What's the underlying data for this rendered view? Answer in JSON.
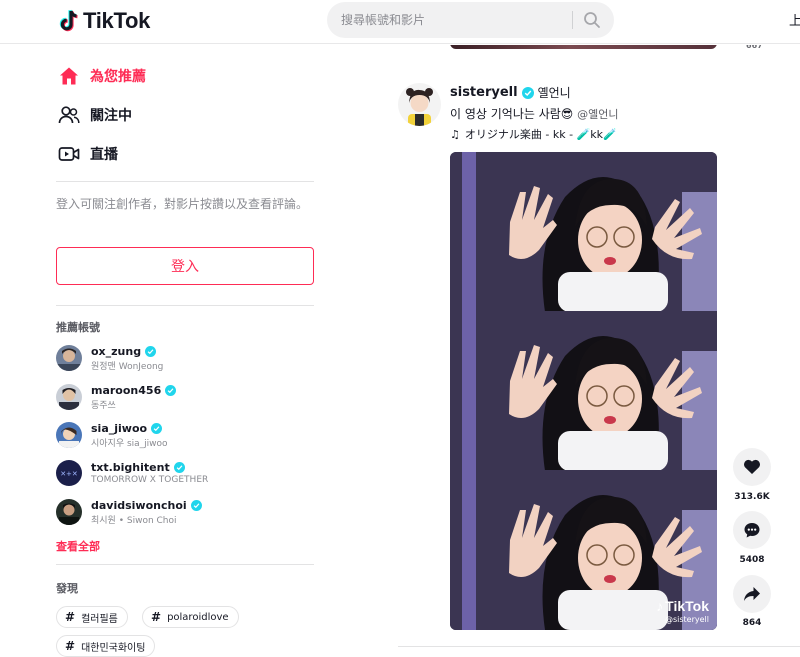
{
  "header": {
    "brand": "TikTok",
    "search_placeholder": "搜尋帳號和影片",
    "upload_label": "上"
  },
  "sidebar": {
    "nav": [
      {
        "label": "為您推薦",
        "icon": "home-icon",
        "active": true
      },
      {
        "label": "關注中",
        "icon": "following-icon",
        "active": false
      },
      {
        "label": "直播",
        "icon": "live-icon",
        "active": false
      }
    ],
    "login_hint": "登入可關注創作者，對影片按讚以及查看評論。",
    "login_button": "登入",
    "suggested_title": "推薦帳號",
    "accounts": [
      {
        "username": "ox_zung",
        "display": "원정맨 WonJeong"
      },
      {
        "username": "maroon456",
        "display": "동주쓰"
      },
      {
        "username": "sia_jiwoo",
        "display": "시아지우 sia_jiwoo"
      },
      {
        "username": "txt.bighitent",
        "display": "TOMORROW X TOGETHER"
      },
      {
        "username": "davidsiwonchoi",
        "display": "최시원 • Siwon Choi"
      }
    ],
    "see_all": "查看全部",
    "discover_title": "發現",
    "tags": [
      "컬러필름",
      "polaroidlove",
      "대한민국화이팅"
    ]
  },
  "feed": {
    "prev_count": "667",
    "post": {
      "author_id": "sisteryell",
      "author_name": "옐언니",
      "caption": "이 영상 기억나는 사람😎",
      "mention": "@옐언니",
      "music": "オリジナル楽曲 - kk - 🧪kk🧪",
      "watermark_brand": "TikTok",
      "watermark_handle": "@sisteryell",
      "likes": "313.6K",
      "comments": "5408",
      "shares": "864"
    }
  },
  "colors": {
    "accent": "#fe2c55",
    "verified": "#20d5ec",
    "text": "#161823",
    "muted": "#8a8b91"
  }
}
